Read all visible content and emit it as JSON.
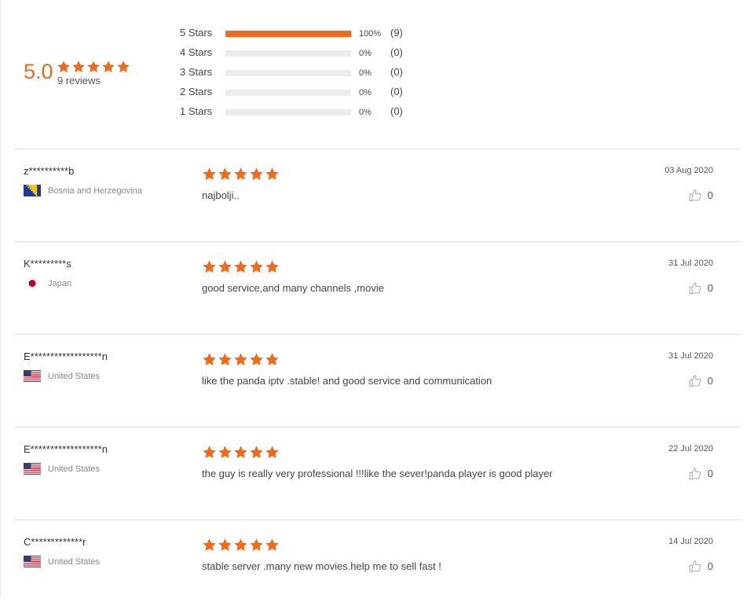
{
  "summary": {
    "average": "5.0",
    "review_count_label": "9 reviews",
    "star_color": "#f06a1a",
    "distribution": [
      {
        "label": "5 Stars",
        "percent": "100%",
        "count": "(9)",
        "fraction": 1.0
      },
      {
        "label": "4 Stars",
        "percent": "0%",
        "count": "(0)",
        "fraction": 0
      },
      {
        "label": "3 Stars",
        "percent": "0%",
        "count": "(0)",
        "fraction": 0
      },
      {
        "label": "2 Stars",
        "percent": "0%",
        "count": "(0)",
        "fraction": 0
      },
      {
        "label": "1 Stars",
        "percent": "0%",
        "count": "(0)",
        "fraction": 0
      }
    ]
  },
  "reviews": [
    {
      "name": "z**********b",
      "country": "Bosnia and Herzegovina",
      "flag": "flag-ba-icon",
      "rating": 5,
      "text": "najbolji..",
      "date": "03 Aug 2020",
      "helpful": "0"
    },
    {
      "name": "K*********s",
      "country": "Japan",
      "flag": "flag-jp-icon",
      "rating": 5,
      "text": "good service,and many channels ,movie",
      "date": "31 Jul 2020",
      "helpful": "0"
    },
    {
      "name": "E******************n",
      "country": "United States",
      "flag": "flag-us-icon",
      "rating": 5,
      "text": "like the panda iptv .stable! and good service and communication",
      "date": "31 Jul 2020",
      "helpful": "0"
    },
    {
      "name": "E******************n",
      "country": "United States",
      "flag": "flag-us-icon",
      "rating": 5,
      "text": "the guy is really very professional !!!like the sever!panda player is good player",
      "date": "22 Jul 2020",
      "helpful": "0"
    },
    {
      "name": "C*************r",
      "country": "United States",
      "flag": "flag-us-icon",
      "rating": 5,
      "text": "stable server .many new movies.help me to sell fast !",
      "date": "14 Jul 2020",
      "helpful": "0"
    }
  ]
}
